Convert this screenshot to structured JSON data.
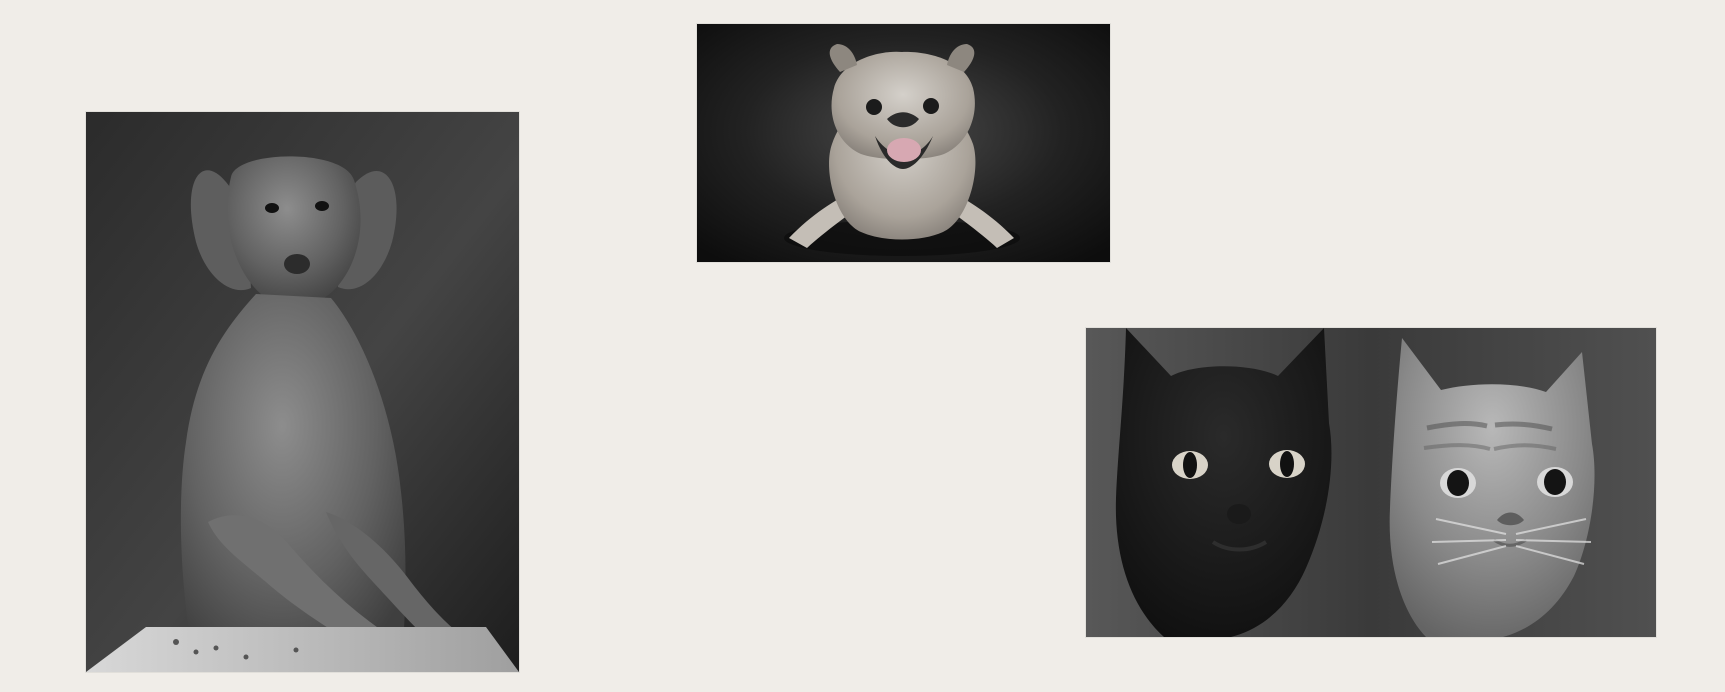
{
  "canvas": {
    "background": "#f0ede8"
  },
  "gallery": {
    "images": [
      {
        "id": "dog-photo",
        "subject": "dog",
        "style": "black-and-white"
      },
      {
        "id": "pug-photo",
        "subject": "pug",
        "style": "black-and-white"
      },
      {
        "id": "cats-photo",
        "subject": "two cats",
        "style": "black-and-white"
      }
    ]
  }
}
